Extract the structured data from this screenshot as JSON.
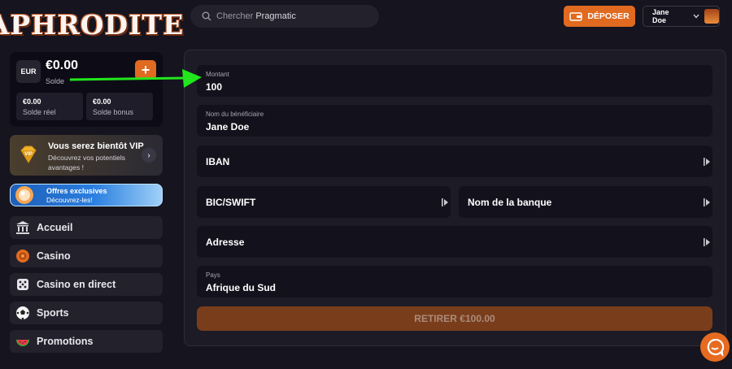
{
  "brand": {
    "logo_text": "APHRODITE"
  },
  "wallet": {
    "currency": "EUR",
    "balance": "€0.00",
    "balance_label": "Solde",
    "real_value": "€0.00",
    "real_label": "Solde réel",
    "bonus_value": "€0.00",
    "bonus_label": "Solde bonus"
  },
  "vip": {
    "title": "Vous serez bientôt VIP",
    "subtitle": "Découvrez vos potentiels avantages !"
  },
  "offers": {
    "title": "Offres exclusives",
    "subtitle": "Découvrez-les!"
  },
  "nav": [
    {
      "label": "Accueil",
      "icon": "bank-icon"
    },
    {
      "label": "Casino",
      "icon": "chip-icon"
    },
    {
      "label": "Casino en direct",
      "icon": "dice-icon"
    },
    {
      "label": "Sports",
      "icon": "soccer-ball-icon"
    },
    {
      "label": "Promotions",
      "icon": "watermelon-icon"
    }
  ],
  "header": {
    "search_prefix": "Chercher",
    "search_suffix": "Pragmatic",
    "deposit_label": "DÉPOSER",
    "user_name": "Jane Doe"
  },
  "form": {
    "amount_label": "Montant",
    "amount_value": "100",
    "beneficiary_label": "Nom du bénéficiaire",
    "beneficiary_value": "Jane Doe",
    "iban_label": "IBAN",
    "bic_label": "BIC/SWIFT",
    "bank_label": "Nom de la banque",
    "address_label": "Adresse",
    "country_label": "Pays",
    "country_value": "Afrique du Sud",
    "submit_label": "RETIRER €100.00"
  },
  "colors": {
    "accent": "#e06a1f",
    "background": "#15141f",
    "field": "#13121c",
    "annotation_arrow": "#22e61c"
  }
}
